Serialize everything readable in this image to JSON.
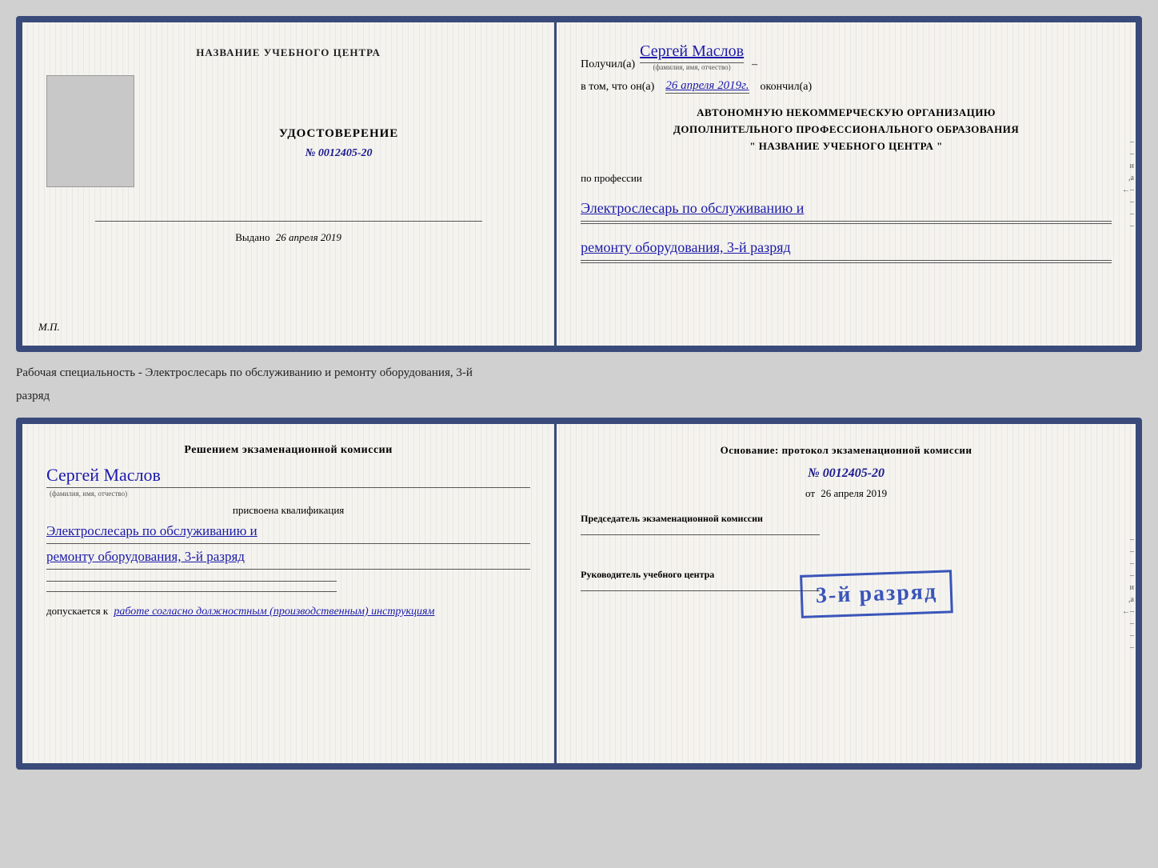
{
  "page": {
    "background_color": "#d0d0d0"
  },
  "cert1": {
    "left": {
      "center_title": "НАЗВАНИЕ УЧЕБНОГО ЦЕНТРА",
      "udostoverenie": "УДОСТОВЕРЕНИЕ",
      "number": "№ 0012405-20",
      "vydano_label": "Выдано",
      "vydano_date": "26 апреля 2019",
      "mp": "М.П."
    },
    "right": {
      "poluchil_prefix": "Получил(а)",
      "name": "Сергей Маслов",
      "name_hint": "(фамилия, имя, отчество)",
      "dash": "–",
      "vtom_prefix": "в том, что он(а)",
      "date_handwritten": "26 апреля 2019г.",
      "okonchil": "окончил(а)",
      "org_line1": "АВТОНОМНУЮ НЕКОММЕРЧЕСКУЮ ОРГАНИЗАЦИЮ",
      "org_line2": "ДОПОЛНИТЕЛЬНОГО ПРОФЕССИОНАЛЬНОГО ОБРАЗОВАНИЯ",
      "org_line3": "\"    НАЗВАНИЕ УЧЕБНОГО ЦЕНТРА    \"",
      "poprofessii": "по профессии",
      "profession_line1": "Электрослесарь по обслуживанию и",
      "profession_line2": "ремонту оборудования, 3-й разряд"
    }
  },
  "between": {
    "text_line1": "Рабочая специальность - Электрослесарь по обслуживанию и ремонту оборудования, 3-й",
    "text_line2": "разряд"
  },
  "cert2": {
    "left": {
      "resheniem_title": "Решением экзаменационной комиссии",
      "name": "Сергей Маслов",
      "name_hint": "(фамилия, имя, отчество)",
      "prisvoena": "присвоена квалификация",
      "qualification_line1": "Электрослесарь по обслуживанию и",
      "qualification_line2": "ремонту оборудования, 3-й разряд",
      "dopuskaetsya_prefix": "допускается к",
      "dopuskaetsya_text": "работе согласно должностным (производственным) инструкциям"
    },
    "right": {
      "osnovanie_label": "Основание: протокол экзаменационной комиссии",
      "number": "№  0012405-20",
      "ot_prefix": "от",
      "ot_date": "26 апреля 2019",
      "predsedatel_label": "Председатель экзаменационной комиссии",
      "rukovoditel_label": "Руководитель учебного центра"
    },
    "stamp": {
      "text": "3-й разряд"
    }
  }
}
